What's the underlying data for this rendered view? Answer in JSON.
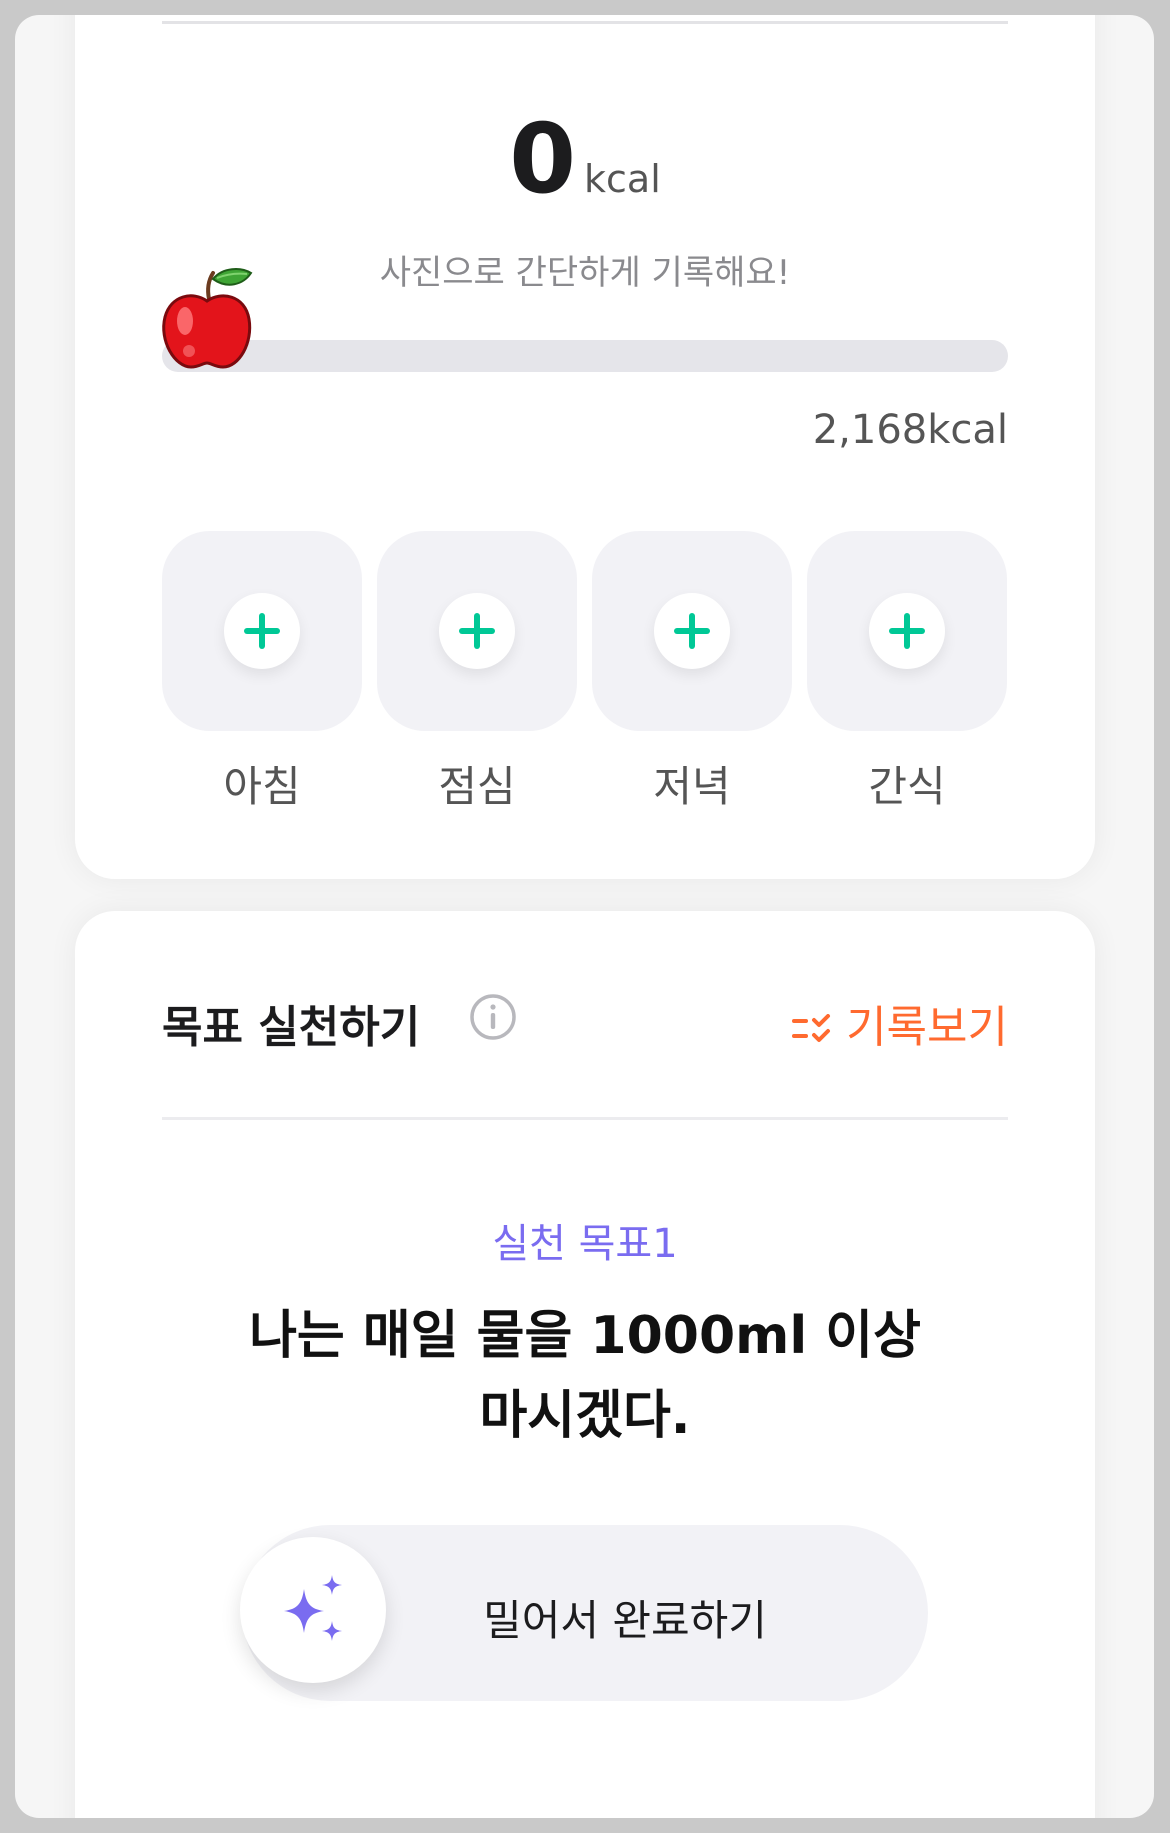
{
  "summary": {
    "kcal_value": "0",
    "kcal_unit": "kcal",
    "hint": "사진으로 간단하게 기록해요!",
    "target_kcal": "2,168kcal",
    "progress_fraction": 0
  },
  "meals": [
    {
      "label": "아침",
      "icon": "plus-icon"
    },
    {
      "label": "점심",
      "icon": "plus-icon"
    },
    {
      "label": "저녁",
      "icon": "plus-icon"
    },
    {
      "label": "간식",
      "icon": "plus-icon"
    }
  ],
  "goals": {
    "title": "목표 실천하기",
    "history_label": "기록보기",
    "goal_label": "실천 목표1",
    "goal_text": "나는 매일 물을 1000ml 이상 마시겠다.",
    "slider_label": "밀어서 완료하기"
  },
  "colors": {
    "accent_green": "#00c896",
    "accent_orange": "#ff6a2f",
    "accent_purple": "#7a6cf0"
  }
}
